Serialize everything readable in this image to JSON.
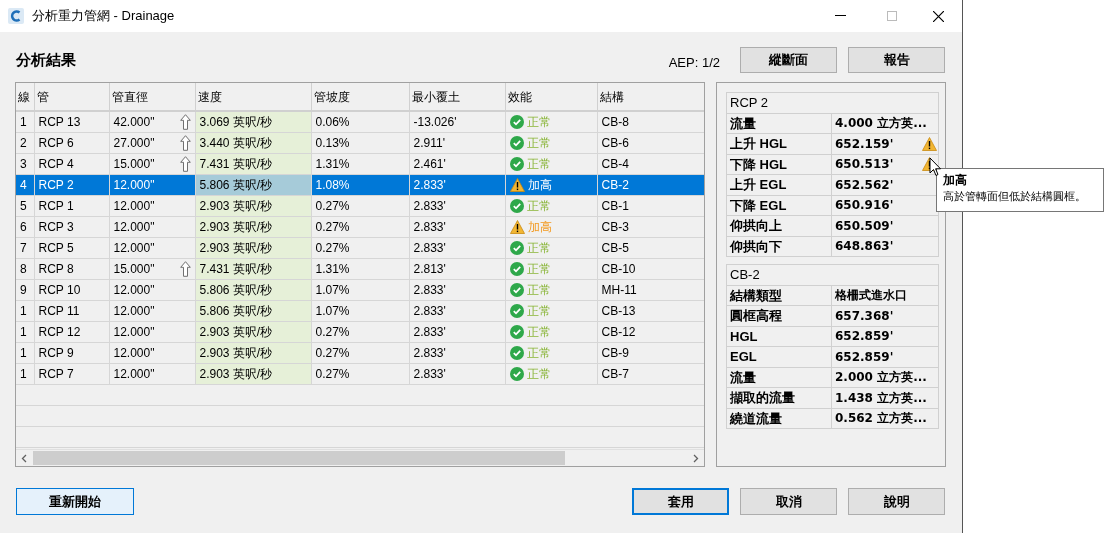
{
  "window": {
    "title": "分析重力管網 - Drainage"
  },
  "heading": "分析結果",
  "aep": "AEP: 1/2",
  "top_buttons": [
    "縱斷面",
    "報告"
  ],
  "table": {
    "columns": [
      "線",
      "管",
      "管直徑",
      "速度",
      "管坡度",
      "最小覆土",
      "效能",
      "結構"
    ],
    "rows": [
      {
        "line": "1",
        "pipe": "RCP 13",
        "diameter": "42.000\"",
        "increased": true,
        "velocity": "3.069 英呎/秒",
        "slope": "0.06%",
        "min_cover": "-13.026'",
        "status": {
          "kind": "ok",
          "label": "正常"
        },
        "structure": "CB-8",
        "selected": false
      },
      {
        "line": "2",
        "pipe": "RCP 6",
        "diameter": "27.000\"",
        "increased": true,
        "velocity": "3.440 英呎/秒",
        "slope": "0.13%",
        "min_cover": "2.911'",
        "status": {
          "kind": "ok",
          "label": "正常"
        },
        "structure": "CB-6",
        "selected": false
      },
      {
        "line": "3",
        "pipe": "RCP 4",
        "diameter": "15.000\"",
        "increased": true,
        "velocity": "7.431 英呎/秒",
        "slope": "1.31%",
        "min_cover": "2.461'",
        "status": {
          "kind": "ok",
          "label": "正常"
        },
        "structure": "CB-4",
        "selected": false
      },
      {
        "line": "4",
        "pipe": "RCP 2",
        "diameter": "12.000\"",
        "increased": false,
        "velocity": "5.806 英呎/秒",
        "slope": "1.08%",
        "min_cover": "2.833'",
        "status": {
          "kind": "raised",
          "label": "加高"
        },
        "structure": "CB-2",
        "selected": true
      },
      {
        "line": "5",
        "pipe": "RCP 1",
        "diameter": "12.000\"",
        "increased": false,
        "velocity": "2.903 英呎/秒",
        "slope": "0.27%",
        "min_cover": "2.833'",
        "status": {
          "kind": "ok",
          "label": "正常"
        },
        "structure": "CB-1",
        "selected": false
      },
      {
        "line": "6",
        "pipe": "RCP 3",
        "diameter": "12.000\"",
        "increased": false,
        "velocity": "2.903 英呎/秒",
        "slope": "0.27%",
        "min_cover": "2.833'",
        "status": {
          "kind": "raised",
          "label": "加高"
        },
        "structure": "CB-3",
        "selected": false
      },
      {
        "line": "7",
        "pipe": "RCP 5",
        "diameter": "12.000\"",
        "increased": false,
        "velocity": "2.903 英呎/秒",
        "slope": "0.27%",
        "min_cover": "2.833'",
        "status": {
          "kind": "ok",
          "label": "正常"
        },
        "structure": "CB-5",
        "selected": false
      },
      {
        "line": "8",
        "pipe": "RCP 8",
        "diameter": "15.000\"",
        "increased": true,
        "velocity": "7.431 英呎/秒",
        "slope": "1.31%",
        "min_cover": "2.813'",
        "status": {
          "kind": "ok",
          "label": "正常"
        },
        "structure": "CB-10",
        "selected": false
      },
      {
        "line": "9",
        "pipe": "RCP 10",
        "diameter": "12.000\"",
        "increased": false,
        "velocity": "5.806 英呎/秒",
        "slope": "1.07%",
        "min_cover": "2.833'",
        "status": {
          "kind": "ok",
          "label": "正常"
        },
        "structure": "MH-11",
        "selected": false
      },
      {
        "line": "1",
        "pipe": "RCP 11",
        "diameter": "12.000\"",
        "increased": false,
        "velocity": "5.806 英呎/秒",
        "slope": "1.07%",
        "min_cover": "2.833'",
        "status": {
          "kind": "ok",
          "label": "正常"
        },
        "structure": "CB-13",
        "selected": false
      },
      {
        "line": "1",
        "pipe": "RCP 12",
        "diameter": "12.000\"",
        "increased": false,
        "velocity": "2.903 英呎/秒",
        "slope": "0.27%",
        "min_cover": "2.833'",
        "status": {
          "kind": "ok",
          "label": "正常"
        },
        "structure": "CB-12",
        "selected": false
      },
      {
        "line": "1",
        "pipe": "RCP 9",
        "diameter": "12.000\"",
        "increased": false,
        "velocity": "2.903 英呎/秒",
        "slope": "0.27%",
        "min_cover": "2.833'",
        "status": {
          "kind": "ok",
          "label": "正常"
        },
        "structure": "CB-9",
        "selected": false
      },
      {
        "line": "1",
        "pipe": "RCP 7",
        "diameter": "12.000\"",
        "increased": false,
        "velocity": "2.903 英呎/秒",
        "slope": "0.27%",
        "min_cover": "2.833'",
        "status": {
          "kind": "ok",
          "label": "正常"
        },
        "structure": "CB-7",
        "selected": false
      }
    ]
  },
  "pipe_details": {
    "title": "RCP 2",
    "rows": [
      {
        "label": "流量",
        "value": "4.000 立方英...",
        "warning": false
      },
      {
        "label": "上升 HGL",
        "value": "652.159'",
        "warning": true
      },
      {
        "label": "下降 HGL",
        "value": "650.513'",
        "warning": true
      },
      {
        "label": "上升 EGL",
        "value": "652.562'",
        "warning": false
      },
      {
        "label": "下降 EGL",
        "value": "650.916'",
        "warning": false
      },
      {
        "label": "仰拱向上",
        "value": "650.509'",
        "warning": false
      },
      {
        "label": "仰拱向下",
        "value": "648.863'",
        "warning": false
      }
    ]
  },
  "structure_details": {
    "title": "CB-2",
    "rows": [
      {
        "label": "結構類型",
        "value": "格柵式進水口",
        "warning": false
      },
      {
        "label": "圓框高程",
        "value": "657.368'",
        "warning": false
      },
      {
        "label": "HGL",
        "value": "652.859'",
        "warning": false
      },
      {
        "label": "EGL",
        "value": "652.859'",
        "warning": false
      },
      {
        "label": "流量",
        "value": "2.000 立方英...",
        "warning": false
      },
      {
        "label": "擷取的流量",
        "value": "1.438 立方英...",
        "warning": false
      },
      {
        "label": "繞道流量",
        "value": "0.562 立方英...",
        "warning": false
      }
    ]
  },
  "tooltip": {
    "title": "加高",
    "text": "高於管轉面但低於結構圓框。"
  },
  "bottom_buttons": [
    {
      "label": "重新開始",
      "kind": "default"
    },
    {
      "label": "套用",
      "kind": "focused"
    },
    {
      "label": "取消",
      "kind": "normal"
    },
    {
      "label": "說明",
      "kind": "normal"
    }
  ]
}
